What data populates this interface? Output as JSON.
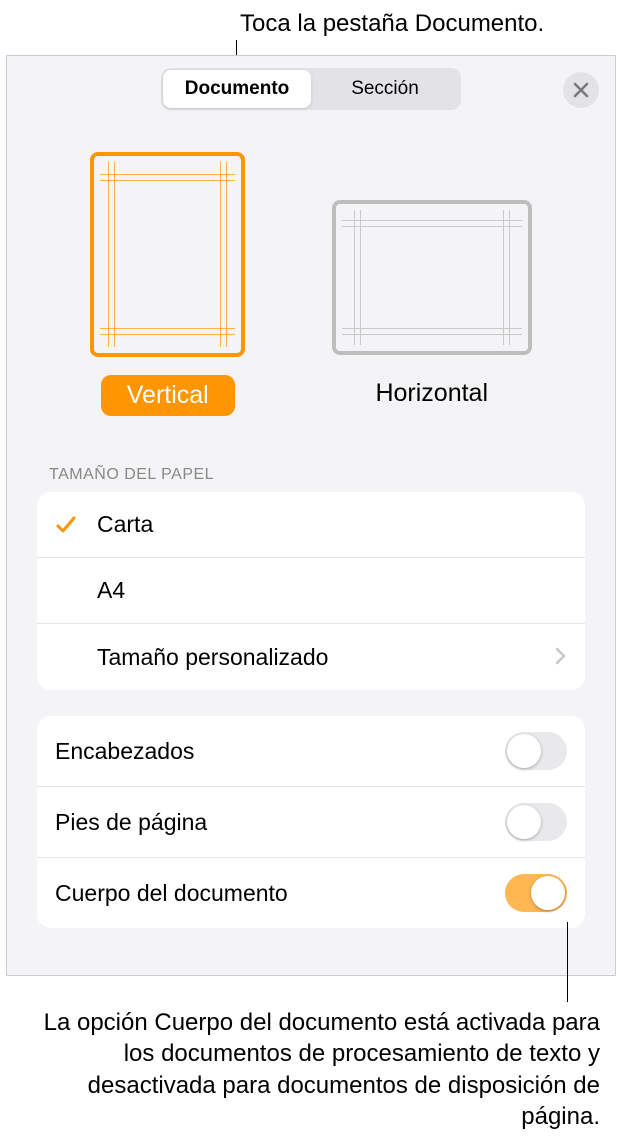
{
  "callouts": {
    "top": "Toca la pestaña Documento.",
    "bottom": "La opción Cuerpo del documento está activada para los documentos de procesamiento de texto y desactivada para documentos de disposición de página."
  },
  "tabs": {
    "document": "Documento",
    "section": "Sección"
  },
  "orientation": {
    "vertical": "Vertical",
    "horizontal": "Horizontal"
  },
  "paper_size": {
    "header": "TAMAÑO DEL PAPEL",
    "options": {
      "letter": "Carta",
      "a4": "A4",
      "custom": "Tamaño personalizado"
    }
  },
  "toggles": {
    "headers": "Encabezados",
    "footers": "Pies de página",
    "body": "Cuerpo del documento"
  },
  "colors": {
    "accent": "#ff9500"
  }
}
